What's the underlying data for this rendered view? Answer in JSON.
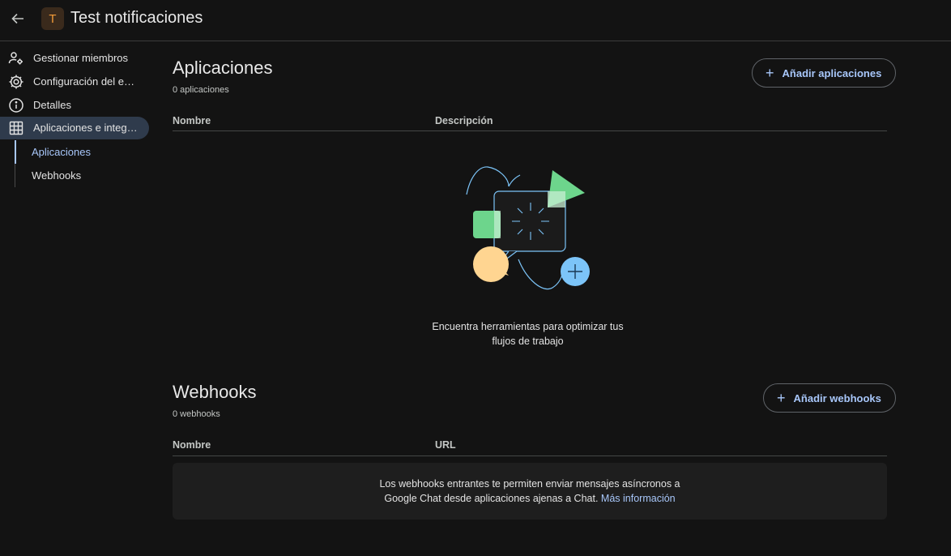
{
  "header": {
    "avatar_letter": "T",
    "title": "Test notificaciones"
  },
  "sidebar": {
    "items": [
      {
        "label": "Gestionar miembros",
        "icon": "manage-members-icon"
      },
      {
        "label": "Configuración del espacio",
        "icon": "gear-icon"
      },
      {
        "label": "Detalles",
        "icon": "info-icon"
      },
      {
        "label": "Aplicaciones e integraciones",
        "icon": "apps-grid-icon",
        "active": true
      }
    ],
    "subitems": [
      {
        "label": "Aplicaciones",
        "active": true
      },
      {
        "label": "Webhooks",
        "active": false
      }
    ]
  },
  "apps": {
    "title": "Aplicaciones",
    "count": "0 aplicaciones",
    "add_label": "Añadir aplicaciones",
    "col_name": "Nombre",
    "col_desc": "Descripción",
    "empty_line1": "Encuentra herramientas para optimizar tus",
    "empty_line2": "flujos de trabajo"
  },
  "webhooks": {
    "title": "Webhooks",
    "count": "0 webhooks",
    "add_label": "Añadir webhooks",
    "col_name": "Nombre",
    "col_url": "URL",
    "info_line1": "Los webhooks entrantes te permiten enviar mensajes asíncronos a",
    "info_line2": "Google Chat desde aplicaciones ajenas a Chat.",
    "info_link": "Más información"
  },
  "colors": {
    "background": "#131313",
    "accent": "#a8c7fa",
    "active_nav": "#2f3b4c",
    "illus_green": "#6dd58c",
    "illus_yellow": "#ffd591",
    "illus_blue": "#7cc4f8"
  }
}
